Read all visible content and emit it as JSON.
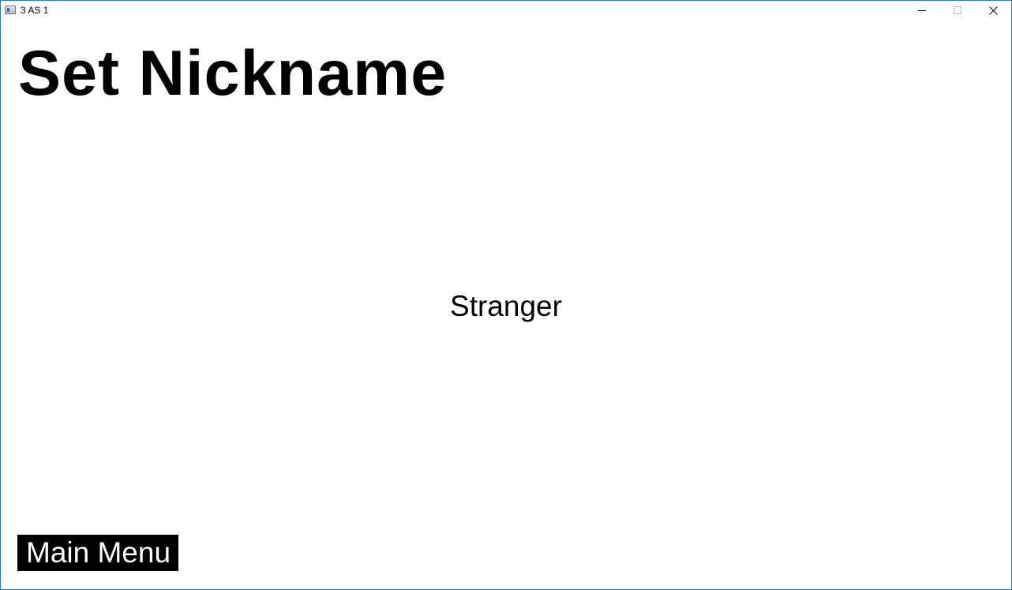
{
  "window": {
    "title": "3 AS 1"
  },
  "screen": {
    "title": "Set Nickname",
    "nickname": "Stranger",
    "main_menu_label": "Main Menu"
  },
  "colors": {
    "background": "#ffffff",
    "text": "#000000",
    "button_background": "#000000",
    "button_text": "#ffffff",
    "window_border": "#2b79c8"
  }
}
